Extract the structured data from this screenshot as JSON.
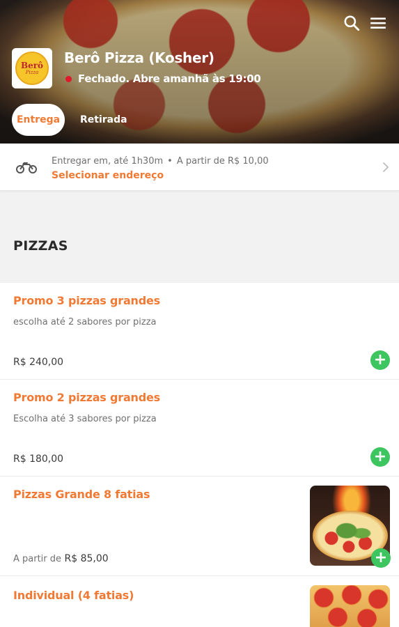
{
  "header": {
    "logo_text": "Berô",
    "logo_subtext": "Pizza",
    "store_name": "Berô Pizza (Kosher)",
    "status": "Fechado. Abre amanhã às 19:00",
    "status_color": "#e0182c",
    "icons": [
      "search-icon",
      "menu-icon"
    ]
  },
  "tabs": [
    {
      "label": "Entrega",
      "active": true
    },
    {
      "label": "Retirada",
      "active": false
    }
  ],
  "delivery": {
    "info_time": "Entregar em, até 1h30m",
    "info_separator": "•",
    "info_min": "A partir de R$ 10,00",
    "select_address": "Selecionar endereço"
  },
  "section": {
    "title": "PIZZAS"
  },
  "items": [
    {
      "name": "Promo 3 pizzas grandes",
      "description": "escolha até 2 sabores por pizza",
      "price": "R$ 240,00"
    },
    {
      "name": "Promo 2 pizzas grandes",
      "description": "Escolha até 3 sabores por pizza",
      "price": "R$ 180,00"
    },
    {
      "name": "Pizzas Grande 8 fatias",
      "price_prefix": "A partir de",
      "price": "R$ 85,00"
    },
    {
      "name": "Individual (4 fatias)"
    }
  ],
  "colors": {
    "accent": "#f07a34",
    "add_button": "#3dc55f"
  }
}
